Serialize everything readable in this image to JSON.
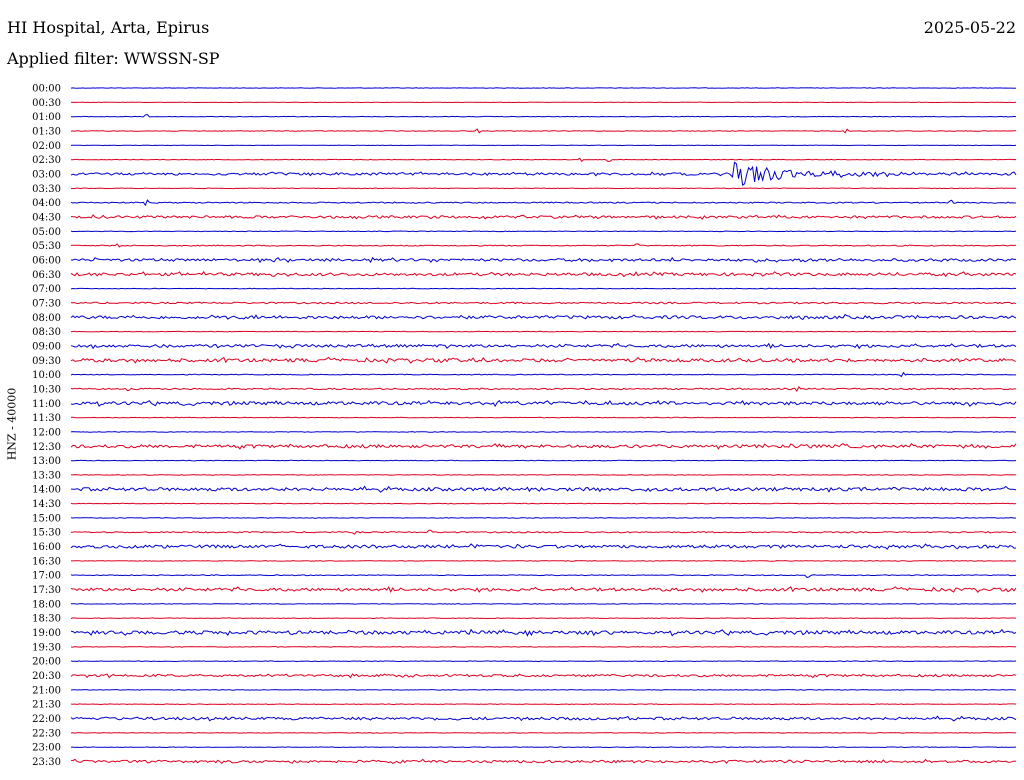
{
  "header": {
    "station": "HI Hospital, Arta, Epirus",
    "date": "2025-05-22",
    "filter": "Applied filter: WWSSN-SP"
  },
  "chart_data": {
    "type": "line",
    "title": "HI Hospital, Arta, Epirus",
    "ylabel": "HNZ - 40000",
    "xlabel": "",
    "colors": {
      "even": "#0000cc",
      "odd": "#dd0022"
    },
    "rows": [
      {
        "label": "00:00",
        "noise": 0.2,
        "spikes": []
      },
      {
        "label": "00:30",
        "noise": 0.2,
        "spikes": []
      },
      {
        "label": "01:00",
        "noise": 0.3,
        "spikes": [
          {
            "t": 0.08,
            "amp": 2
          }
        ]
      },
      {
        "label": "01:30",
        "noise": 0.3,
        "spikes": [
          {
            "t": 0.43,
            "amp": 2
          },
          {
            "t": 0.82,
            "amp": 1.5
          }
        ]
      },
      {
        "label": "02:00",
        "noise": 0.2,
        "spikes": []
      },
      {
        "label": "02:30",
        "noise": 0.3,
        "spikes": [
          {
            "t": 0.54,
            "amp": 1.5
          },
          {
            "t": 0.57,
            "amp": 1.5
          }
        ]
      },
      {
        "label": "03:00",
        "noise": 1.2,
        "event": {
          "start": 0.697,
          "peak": 13,
          "decay": 0.07
        }
      },
      {
        "label": "03:30",
        "noise": 0.3,
        "spikes": []
      },
      {
        "label": "04:00",
        "noise": 0.6,
        "spikes": [
          {
            "t": 0.08,
            "amp": 2
          },
          {
            "t": 0.93,
            "amp": 2
          }
        ]
      },
      {
        "label": "04:30",
        "noise": 1.2,
        "spikes": []
      },
      {
        "label": "05:00",
        "noise": 0.3,
        "spikes": []
      },
      {
        "label": "05:30",
        "noise": 0.5,
        "spikes": [
          {
            "t": 0.05,
            "amp": 1.5
          },
          {
            "t": 0.6,
            "amp": 1.5
          }
        ]
      },
      {
        "label": "06:00",
        "noise": 1.3,
        "spikes": []
      },
      {
        "label": "06:30",
        "noise": 1.4,
        "spikes": []
      },
      {
        "label": "07:00",
        "noise": 0.3,
        "spikes": []
      },
      {
        "label": "07:30",
        "noise": 0.8,
        "spikes": []
      },
      {
        "label": "08:00",
        "noise": 1.5,
        "spikes": []
      },
      {
        "label": "08:30",
        "noise": 0.3,
        "spikes": []
      },
      {
        "label": "09:00",
        "noise": 1.4,
        "spikes": []
      },
      {
        "label": "09:30",
        "noise": 1.6,
        "spikes": []
      },
      {
        "label": "10:00",
        "noise": 0.4,
        "spikes": [
          {
            "t": 0.88,
            "amp": 2
          }
        ]
      },
      {
        "label": "10:30",
        "noise": 0.7,
        "spikes": [
          {
            "t": 0.06,
            "amp": 2
          },
          {
            "t": 0.77,
            "amp": 1.5
          }
        ]
      },
      {
        "label": "11:00",
        "noise": 1.6,
        "spikes": []
      },
      {
        "label": "11:30",
        "noise": 0.3,
        "spikes": []
      },
      {
        "label": "12:00",
        "noise": 0.3,
        "spikes": []
      },
      {
        "label": "12:30",
        "noise": 1.5,
        "spikes": []
      },
      {
        "label": "13:00",
        "noise": 0.3,
        "spikes": []
      },
      {
        "label": "13:30",
        "noise": 0.3,
        "spikes": []
      },
      {
        "label": "14:00",
        "noise": 1.6,
        "spikes": []
      },
      {
        "label": "14:30",
        "noise": 0.3,
        "spikes": []
      },
      {
        "label": "15:00",
        "noise": 0.3,
        "spikes": []
      },
      {
        "label": "15:30",
        "noise": 0.6,
        "spikes": [
          {
            "t": 0.3,
            "amp": 1.5
          },
          {
            "t": 0.38,
            "amp": 1.5
          }
        ]
      },
      {
        "label": "16:00",
        "noise": 1.5,
        "spikes": []
      },
      {
        "label": "16:30",
        "noise": 0.3,
        "spikes": []
      },
      {
        "label": "17:00",
        "noise": 0.4,
        "spikes": [
          {
            "t": 0.78,
            "amp": 2
          }
        ]
      },
      {
        "label": "17:30",
        "noise": 1.5,
        "spikes": []
      },
      {
        "label": "18:00",
        "noise": 0.3,
        "spikes": []
      },
      {
        "label": "18:30",
        "noise": 0.3,
        "spikes": []
      },
      {
        "label": "19:00",
        "noise": 1.7,
        "spikes": []
      },
      {
        "label": "19:30",
        "noise": 0.3,
        "spikes": []
      },
      {
        "label": "20:00",
        "noise": 0.3,
        "spikes": []
      },
      {
        "label": "20:30",
        "noise": 1.1,
        "spikes": []
      },
      {
        "label": "21:00",
        "noise": 0.3,
        "spikes": []
      },
      {
        "label": "21:30",
        "noise": 0.3,
        "spikes": []
      },
      {
        "label": "22:00",
        "noise": 1.3,
        "spikes": []
      },
      {
        "label": "22:30",
        "noise": 0.3,
        "spikes": []
      },
      {
        "label": "23:00",
        "noise": 0.3,
        "spikes": []
      },
      {
        "label": "23:30",
        "noise": 1.2,
        "spikes": []
      }
    ]
  }
}
